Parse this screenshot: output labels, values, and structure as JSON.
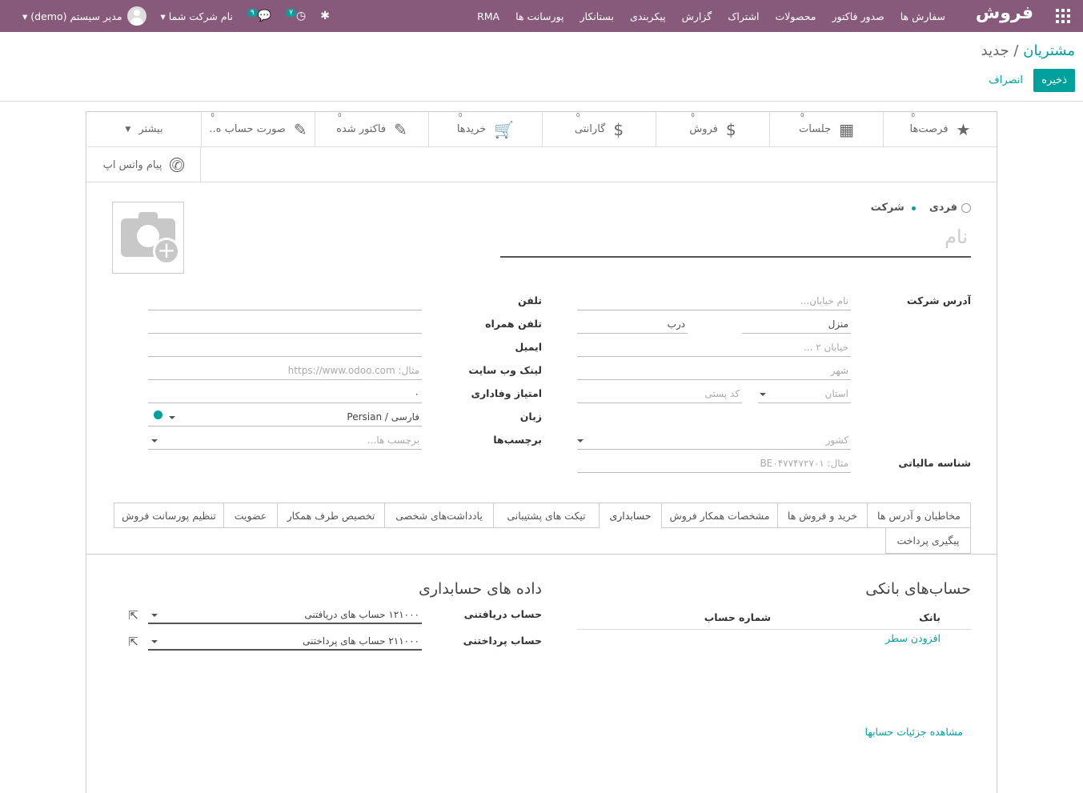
{
  "topbar": {
    "brand": "فروش",
    "menu": [
      "سفارش ها",
      "صدور فاکتور",
      "محصولات",
      "اشتراک",
      "گزارش",
      "پیکربندی",
      "بستانکار",
      "پورسانت ها",
      "RMA"
    ],
    "company": "نام شرکت شما",
    "user": "مدیر سیستم (demo)",
    "messages_badge": "۹",
    "activity_badge": "۷"
  },
  "breadcrumb": {
    "parent": "مشتریان",
    "sep": "/",
    "current": "جدید"
  },
  "actions": {
    "save": "ذخیره",
    "discard": "انصراف"
  },
  "smart_buttons": [
    {
      "label": "فرصت‌ها",
      "icon": "star-icon"
    },
    {
      "label": "جلسات",
      "icon": "calendar-icon"
    },
    {
      "label": "فروش",
      "icon": "dollar-icon"
    },
    {
      "label": "گارانتی",
      "icon": "dollar-icon"
    },
    {
      "label": "خریدها",
      "icon": "cart-icon"
    },
    {
      "label": "فاکتور شده",
      "icon": "edit-icon"
    },
    {
      "label": "صورت حساب ه..",
      "icon": "edit-icon"
    },
    {
      "label": "بیشتر",
      "icon": "caret-icon"
    },
    {
      "label": "پیام واتس اپ",
      "icon": "whatsapp-icon"
    }
  ],
  "partner_type": {
    "individual": "فردی",
    "company": "شرکت"
  },
  "name_placeholder": "نام",
  "address": {
    "label": "آدرس شرکت",
    "street": "نام خیابان...",
    "house": "منزل",
    "door": "درب",
    "street2": "خیابان ۲ ...",
    "city": "شهر",
    "state": "استان",
    "zip": "کد پستی",
    "country": "کشور"
  },
  "vat": {
    "label": "شناسه مالیاتی",
    "placeholder": "مثال: BE۰۴۷۷۴۷۲۷۰۱"
  },
  "right_fields": {
    "phone": "تلفن",
    "mobile": "تلفن همراه",
    "email": "ایمیل",
    "website": "لینک وب سایت",
    "website_ph": "مثال: https://www.odoo.com",
    "loyalty": "امتیاز وفاداری",
    "loyalty_val": "۰",
    "lang": "زبان",
    "lang_val": "Persian / فارسی",
    "tags": "برچسب‌ها",
    "tags_ph": "برچسب ها..."
  },
  "tabs": [
    "مخاطبان و آدرس ها",
    "خرید و فروش ها",
    "مشخصات همکار فروش",
    "حسابداری",
    "تیکت های پشتیبانی",
    "یادداشت‌های شخصی",
    "تخصیص طرف همکار",
    "عضویت",
    "تنظیم پورسانت فروش",
    "پیگیری پرداخت"
  ],
  "bank": {
    "title": "حساب‌های بانکی",
    "col_bank": "بانک",
    "col_account": "شماره حساب",
    "add_line": "افزودن سطر",
    "view_details": "مشاهده جزئیات حسابها"
  },
  "accounting": {
    "title": "داده های حسابداری",
    "receivable_label": "حساب دریافتنی",
    "receivable_val": "۱۲۱۰۰۰ حساب های دریافتنی",
    "payable_label": "حساب پرداختنی",
    "payable_val": "۲۱۱۰۰۰ حساب های پرداختنی"
  }
}
